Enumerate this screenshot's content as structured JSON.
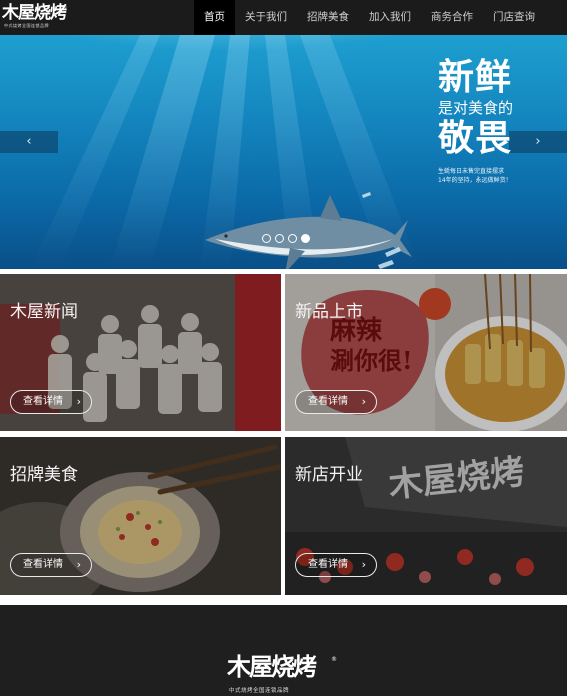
{
  "brand": {
    "name": "木屋烧烤",
    "registered": "®",
    "tagline": "中式烧烤全国连锁品牌"
  },
  "nav": {
    "items": [
      "首页",
      "关于我们",
      "招牌美食",
      "加入我们",
      "商务合作",
      "门店查询"
    ],
    "active_index": 0
  },
  "hero": {
    "line1": "新鲜",
    "line2": "是对美食的",
    "line3": "敬畏",
    "caption_1": "生蚝每日未售完直接摆求",
    "caption_2": "14年的坚持，永远做鲜货！",
    "prev_icon": "‹",
    "next_icon": "›",
    "slide_count": 4,
    "active_slide": 4
  },
  "tiles": [
    {
      "title": "木屋新闻",
      "button": "查看详情",
      "chevron": "›"
    },
    {
      "title": "新品上市",
      "button": "查看详情",
      "chevron": "›"
    },
    {
      "title": "招牌美食",
      "button": "查看详情",
      "chevron": "›"
    },
    {
      "title": "新店开业",
      "button": "查看详情",
      "chevron": "›"
    }
  ],
  "footer": {
    "logo": "木屋烧烤",
    "registered": "®",
    "tagline": "中式烧烤全国连锁品牌"
  },
  "colors": {
    "nav_bg": "#1b1b1b",
    "active_bg": "#000000",
    "footer_bg": "#1f1f1f",
    "sea_blue": "#1486bf"
  }
}
